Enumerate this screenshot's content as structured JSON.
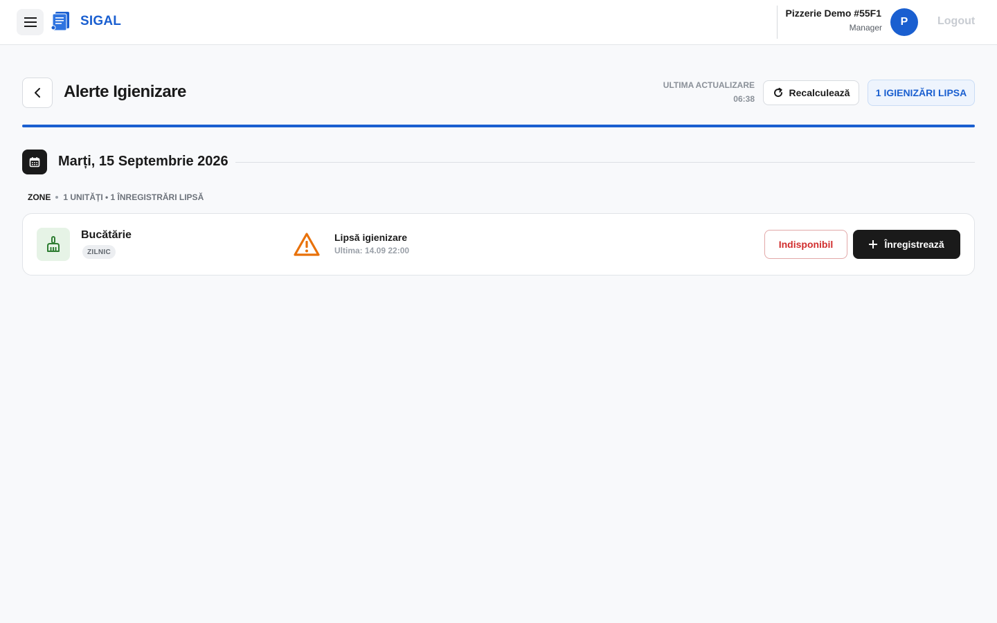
{
  "header": {
    "brand": "SIGAL",
    "user_name": "Pizzerie Demo #55F1",
    "user_role": "Manager",
    "avatar_initial": "P",
    "logout_label": "Logout",
    "icons": {
      "menu": "hamburger-icon",
      "logo": "document-stack-icon"
    }
  },
  "page": {
    "title": "Alerte Igienizare",
    "last_update_label": "ULTIMA ACTUALIZARE",
    "last_update_time": "06:38",
    "recalc_label": "Recalculează",
    "missing_badge": "1 IGIENIZĂRI LIPSA"
  },
  "date_section": {
    "date": "Marți, 15 Septembrie 2026",
    "zone_label": "ZONE",
    "zone_counts": "1 UNITĂȚI • 1 ÎNREGISTRĂRI LIPSĂ"
  },
  "zones": [
    {
      "name": "Bucătărie",
      "frequency": "ZILNIC",
      "alert_title": "Lipsă igienizare",
      "alert_sub": "Ultima: 14.09 22:00",
      "unavailable_label": "Indisponibil",
      "register_label": "Înregistrează"
    }
  ],
  "colors": {
    "accent": "#1a5fd0",
    "warning": "#e8710a",
    "danger": "#d12e2e",
    "zone_icon_bg": "#e6f3e6",
    "zone_icon": "#2e7d32"
  }
}
